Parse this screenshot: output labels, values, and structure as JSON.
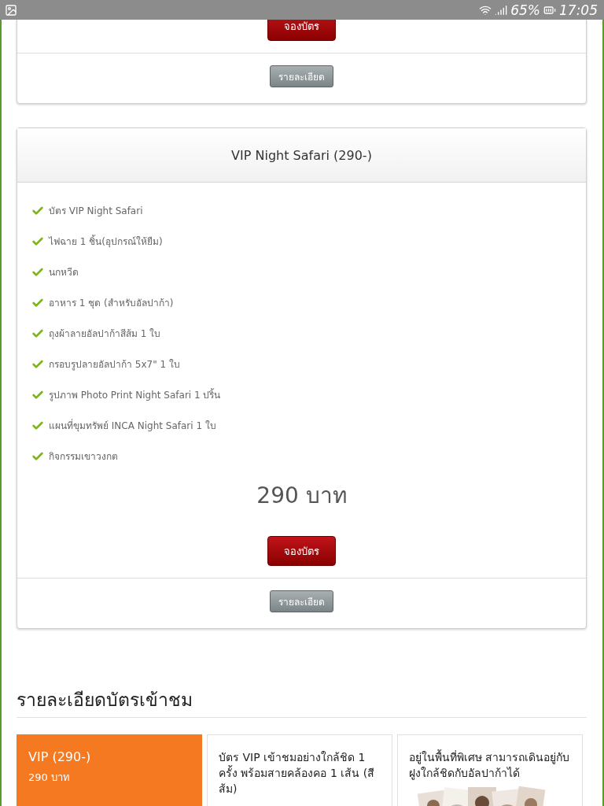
{
  "status_bar": {
    "battery_text": "65%",
    "time": "17:05"
  },
  "top_card": {
    "book_button": "จองบัตร",
    "details_button": "รายละเอียด"
  },
  "package_card": {
    "title": "VIP Night Safari (290-)",
    "items": [
      "บัตร VIP Night Safari",
      "ไฟฉาย 1 ชิ้น(อุปกรณ์ให้ยืม)",
      "นกหวีด",
      "อาหาร 1 ชุด (สำหรับอัลปาก้า)",
      "ถุงผ้าลายอัลปาก้าสีส้ม 1 ใบ",
      "กรอบรูปลายอัลปาก้า 5x7\" 1 ใบ",
      "รูปภาพ Photo Print Night Safari 1 ปริ้น",
      "แผนที่ขุมทรัพย์ INCA Night Safari 1 ใบ",
      "กิจกรรมเขาวงกต"
    ],
    "price": "290 บาท",
    "book_button": "จองบัตร",
    "details_button": "รายละเอียด"
  },
  "ticket_details": {
    "heading": "รายละเอียดบัตรเข้าชม",
    "tiles": [
      {
        "kind": "highlight",
        "title": "VIP (290-)",
        "subtitle": "290 บาท"
      },
      {
        "kind": "text",
        "text": "บัตร VIP เข้าชมอย่างใกล้ชิด 1 ครั้ง พร้อมสายคล้องคอ 1 เส้น (สีส้ม)"
      },
      {
        "kind": "picture",
        "text": "อยู่ในพื้นที่พิเศษ สามารถเดินอยู่กับฝูงใกล้ชิดกับอัลปาก้าได้"
      }
    ]
  }
}
